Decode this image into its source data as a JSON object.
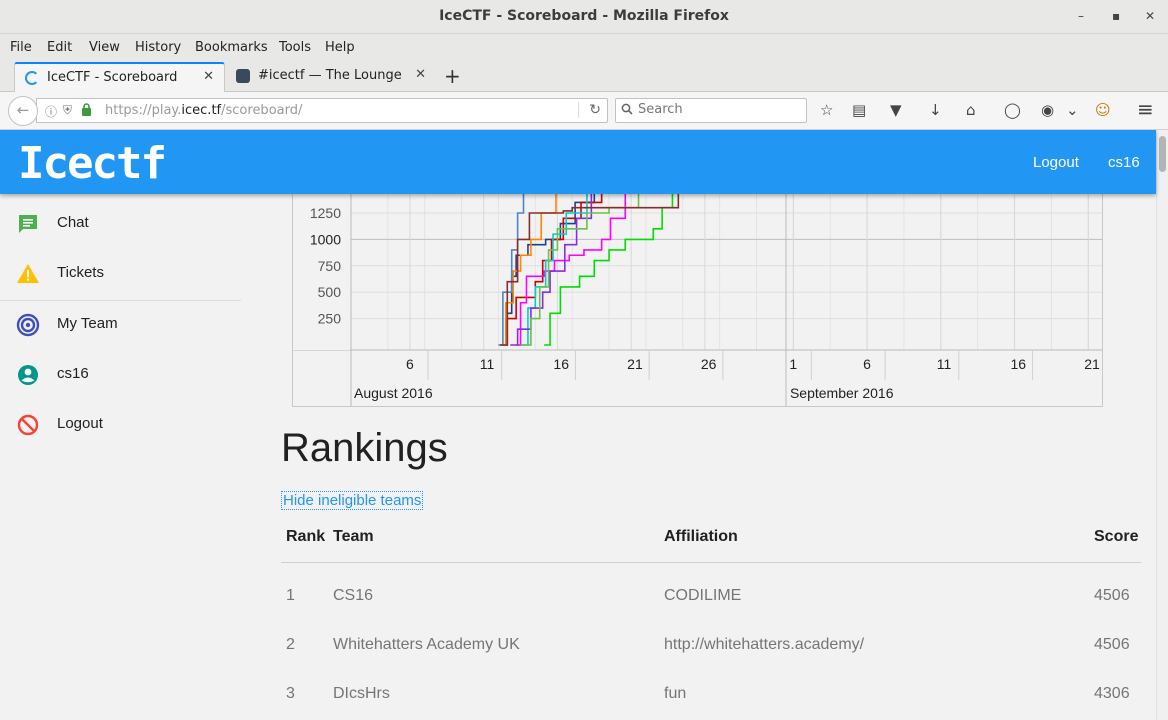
{
  "window": {
    "title": "IceCTF - Scoreboard - Mozilla Firefox",
    "minimize": "–",
    "maximize": "▪",
    "close": "✕"
  },
  "menu": [
    "File",
    "Edit",
    "View",
    "History",
    "Bookmarks",
    "Tools",
    "Help"
  ],
  "tabs": [
    {
      "label": "IceCTF - Scoreboard",
      "close": "✕"
    },
    {
      "label": "#icectf — The Lounge",
      "close": "✕"
    }
  ],
  "new_tab": "+",
  "nav": {
    "back": "←",
    "url_prefix": "https://play.",
    "url_host": "icec.tf",
    "url_suffix": "/scoreboard/",
    "reload": "↻",
    "search_placeholder": "Search"
  },
  "icons": {
    "info": "ⓘ",
    "shield": "⛨",
    "lock": "🔒",
    "search": "🔍",
    "star": "☆",
    "reader": "▤",
    "pocket": "▼",
    "download": "↓",
    "home": "⌂",
    "chat": "◯",
    "mask": "◉",
    "chevron": "⌄",
    "profile": "☺",
    "menu": "≡"
  },
  "header": {
    "logo": "Icectf",
    "logout": "Logout",
    "user": "cs16"
  },
  "sidebar": {
    "items": [
      {
        "label": "Chat",
        "color": "#4caf50"
      },
      {
        "label": "Tickets",
        "color": "#ffc107"
      },
      {
        "label": "My Team",
        "color": "#3f51b5"
      },
      {
        "label": "cs16",
        "color": "#009688"
      },
      {
        "label": "Logout",
        "color": "#f44336"
      }
    ]
  },
  "chart_data": {
    "type": "line",
    "y_ticks": [
      250,
      500,
      750,
      1000,
      1250
    ],
    "x_ticks": [
      {
        "label": "6",
        "day": 6
      },
      {
        "label": "11",
        "day": 11
      },
      {
        "label": "16",
        "day": 16
      },
      {
        "label": "21",
        "day": 21
      },
      {
        "label": "26",
        "day": 26
      },
      {
        "label": "1",
        "day": 32
      },
      {
        "label": "6",
        "day": 37
      },
      {
        "label": "11",
        "day": 42
      },
      {
        "label": "16",
        "day": 47
      },
      {
        "label": "21",
        "day": 52
      }
    ],
    "month_labels": [
      "August 2016",
      "September 2016"
    ],
    "xlim": [
      2,
      53
    ],
    "ylim": [
      0,
      1450
    ],
    "series": [
      {
        "color": "#1f3f8c",
        "points": [
          [
            12.5,
            0
          ],
          [
            12.6,
            300
          ],
          [
            12.9,
            650
          ],
          [
            13.2,
            850
          ],
          [
            14,
            950
          ],
          [
            15.2,
            1000
          ],
          [
            16.2,
            1150
          ],
          [
            17.2,
            1350
          ],
          [
            18.5,
            1450
          ]
        ]
      },
      {
        "color": "#cc0000",
        "points": [
          [
            12.3,
            0
          ],
          [
            12.5,
            250
          ],
          [
            13.2,
            450
          ],
          [
            14.5,
            600
          ],
          [
            15,
            800
          ],
          [
            15.6,
            1000
          ],
          [
            16.4,
            1200
          ],
          [
            17.6,
            1350
          ],
          [
            19,
            1450
          ]
        ]
      },
      {
        "color": "#ff00ff",
        "points": [
          [
            13.2,
            0
          ],
          [
            13.5,
            400
          ],
          [
            13.9,
            650
          ],
          [
            15.1,
            700
          ],
          [
            15.8,
            800
          ],
          [
            16.8,
            850
          ],
          [
            17.8,
            900
          ],
          [
            19,
            1000
          ],
          [
            19.6,
            1200
          ],
          [
            20.6,
            1450
          ]
        ]
      },
      {
        "color": "#00dd00",
        "points": [
          [
            15.1,
            0
          ],
          [
            15.5,
            300
          ],
          [
            16.2,
            550
          ],
          [
            17.5,
            650
          ],
          [
            18.5,
            800
          ],
          [
            19.5,
            900
          ],
          [
            20.6,
            1000
          ],
          [
            22.5,
            1100
          ],
          [
            23.1,
            1300
          ],
          [
            23.8,
            1450
          ]
        ]
      },
      {
        "color": "#00cccc",
        "points": [
          [
            13.5,
            0
          ],
          [
            14,
            350
          ],
          [
            14.5,
            550
          ],
          [
            15.2,
            800
          ],
          [
            15.7,
            1050
          ],
          [
            16.6,
            1250
          ],
          [
            18,
            1450
          ]
        ]
      },
      {
        "color": "#ff8800",
        "points": [
          [
            12.2,
            0
          ],
          [
            12.5,
            400
          ],
          [
            13,
            700
          ],
          [
            13.5,
            850
          ],
          [
            14.2,
            1000
          ],
          [
            14.9,
            1250
          ],
          [
            15.9,
            1450
          ]
        ]
      },
      {
        "color": "#4a86c8",
        "points": [
          [
            12,
            0
          ],
          [
            12.3,
            500
          ],
          [
            12.9,
            900
          ],
          [
            13.3,
            1250
          ],
          [
            13.7,
            1450
          ]
        ]
      },
      {
        "color": "#8a2be2",
        "points": [
          [
            12.8,
            0
          ],
          [
            13.3,
            150
          ],
          [
            14.2,
            350
          ],
          [
            15,
            500
          ],
          [
            15.5,
            700
          ],
          [
            16.5,
            950
          ],
          [
            17.3,
            1200
          ],
          [
            18.3,
            1450
          ]
        ]
      },
      {
        "color": "#6cbf47",
        "points": [
          [
            13.5,
            0
          ],
          [
            14.2,
            250
          ],
          [
            14.8,
            550
          ],
          [
            15.4,
            900
          ],
          [
            16,
            1100
          ],
          [
            18,
            1250
          ],
          [
            19.5,
            1300
          ],
          [
            21.5,
            1450
          ]
        ]
      },
      {
        "color": "#8b2b2b",
        "points": [
          [
            12.1,
            0
          ],
          [
            12.6,
            600
          ],
          [
            13.3,
            1000
          ],
          [
            14.1,
            1250
          ],
          [
            16.4,
            1270
          ],
          [
            17,
            1300
          ],
          [
            23.5,
            1300
          ],
          [
            24.2,
            1450
          ]
        ]
      }
    ]
  },
  "rankings": {
    "title": "Rankings",
    "hide_link": "Hide ineligible teams",
    "columns": [
      "Rank",
      "Team",
      "Affiliation",
      "Score"
    ],
    "rows": [
      {
        "rank": "1",
        "team": "CS16",
        "affiliation": "CODILIME",
        "score": "4506"
      },
      {
        "rank": "2",
        "team": "Whitehatters Academy UK",
        "affiliation": "http://whitehatters.academy/",
        "score": "4506"
      },
      {
        "rank": "3",
        "team": "DIcsHrs",
        "affiliation": "fun",
        "score": "4306"
      }
    ]
  }
}
